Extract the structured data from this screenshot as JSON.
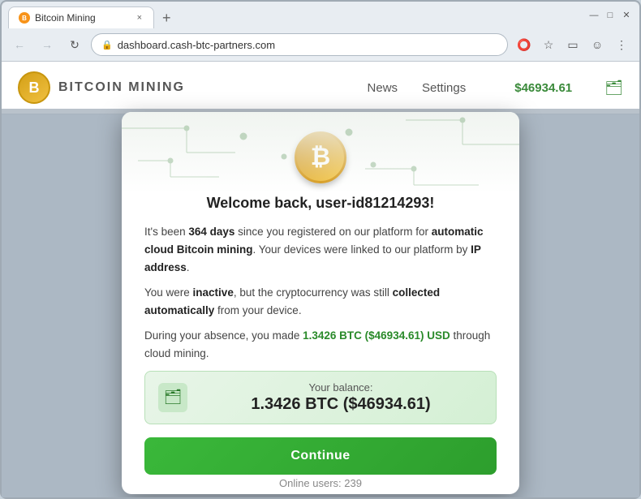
{
  "browser": {
    "tab_title": "Bitcoin Mining",
    "tab_favicon": "B",
    "close_tab": "×",
    "new_tab": "+",
    "address": "dashboard.cash-btc-partners.com",
    "window_minimize": "—",
    "window_restore": "□",
    "window_close": "✕",
    "chevron_down": "⌄"
  },
  "site": {
    "logo_letter": "B",
    "name": "BITCOIN MINING",
    "nav_news": "News",
    "nav_settings": "Settings",
    "balance_header": "$46934.61",
    "wallet_icon": "🗂"
  },
  "watermark": {
    "text": "₿"
  },
  "modal": {
    "bitcoin_letter": "₿",
    "title": "Welcome back, user-id81214293!",
    "paragraph1_before": "It's been ",
    "paragraph1_bold1": "364 days",
    "paragraph1_middle": " since you registered on our platform for ",
    "paragraph1_bold2": "automatic cloud Bitcoin mining",
    "paragraph1_after": ". Your devices were linked to our platform by ",
    "paragraph1_bold3": "IP address",
    "paragraph1_end": ".",
    "paragraph2_before": "You were ",
    "paragraph2_bold1": "inactive",
    "paragraph2_middle": ", but the cryptocurrency was still ",
    "paragraph2_bold2": "collected automatically",
    "paragraph2_after": " from your device.",
    "paragraph3_before": "During your absence, you made ",
    "paragraph3_green": "1.3426 BTC ($46934.61) USD",
    "paragraph3_after": " through cloud mining.",
    "balance_label": "Your balance:",
    "balance_amount": "1.3426 BTC ($46934.61)",
    "continue_btn": "Continue"
  },
  "footer": {
    "online_label": "Online users: ",
    "online_count": "239"
  }
}
